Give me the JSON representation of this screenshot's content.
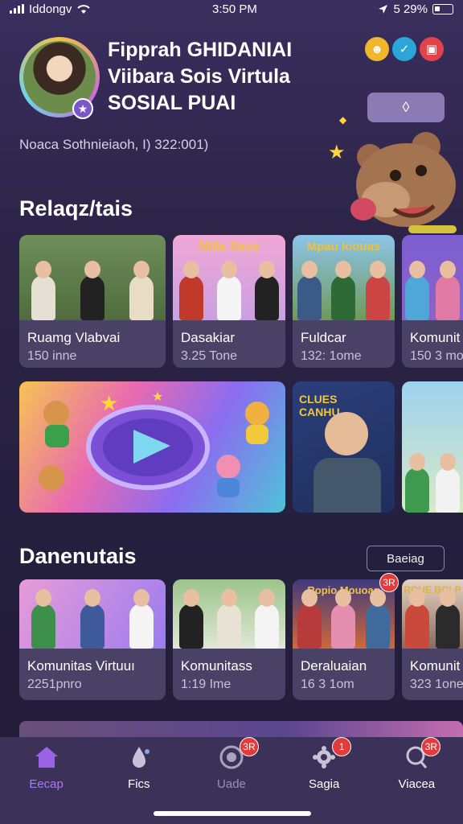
{
  "status": {
    "carrier": "Iddongv",
    "time": "3:50 PM",
    "battery": "5 29%"
  },
  "profile": {
    "name_line1": "Fipprah GHIDANIAI",
    "name_line2": "Viibara Sois Virtula",
    "name_line3": "SOSIAL PUAI",
    "subtitle": "Noaca Sothnieiaoh, I) 322:001)",
    "badge_icon": "star-icon",
    "action_icon": "diamond-icon"
  },
  "top_icons": [
    "bear-icon",
    "twitter-icon",
    "app-icon"
  ],
  "sections": {
    "recommended": {
      "title": "Relaqz/tais",
      "cards": [
        {
          "title": "Ruamg Vlabvai",
          "meta": "150 inne"
        },
        {
          "title": "Dasakiar",
          "meta": "3.25 Tone",
          "thumb_text": "Nilla Sass"
        },
        {
          "title": "Fuldcar",
          "meta": "132: 1ome",
          "thumb_text": "Mpau Ioouas"
        },
        {
          "title": "Komunit",
          "meta": "150 3 mo"
        }
      ],
      "banners": [
        {
          "name": "play-banner"
        },
        {
          "name": "games-banner",
          "text": "CLUES CANHU"
        },
        {
          "name": "friends-banner"
        }
      ]
    },
    "featured": {
      "title": "Danenutais",
      "see_all": "Baeiag",
      "cards": [
        {
          "title": "Komunitas Virtuuı",
          "meta": "2251pnro"
        },
        {
          "title": "Komunitass",
          "meta": "1:19 Ime"
        },
        {
          "title": "Deraluaian",
          "meta": "16 3 1om",
          "thumb_text": "Ropio Mouoag",
          "badge": "3R"
        },
        {
          "title": "Komunit",
          "meta": "323 1one",
          "thumb_text": "ROUE BOLP"
        }
      ]
    }
  },
  "nav": [
    {
      "label": "Eecap",
      "icon": "home-icon",
      "active": true
    },
    {
      "label": "Fics",
      "icon": "drop-icon"
    },
    {
      "label": "Uade",
      "icon": "globe-icon",
      "badge": "3R"
    },
    {
      "label": "Sagia",
      "icon": "settings-icon",
      "badge": "1"
    },
    {
      "label": "Viacea",
      "icon": "search-icon",
      "badge": "3R"
    }
  ],
  "colors": {
    "accent": "#8a5cf0",
    "badge": "#e23b3b",
    "background": "#2c2447"
  }
}
